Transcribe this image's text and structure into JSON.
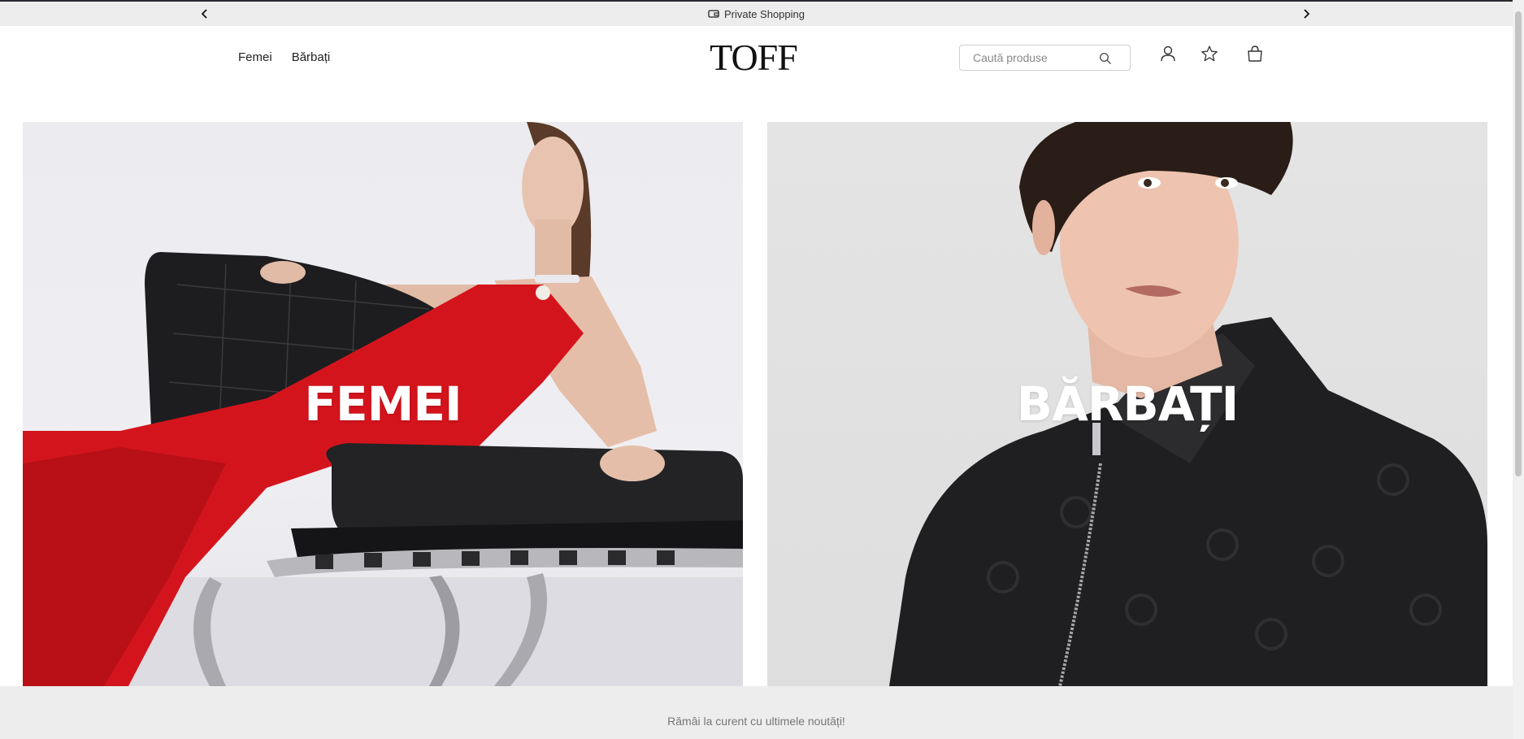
{
  "announcement": {
    "text": "Private Shopping",
    "icon": "wallet-icon",
    "prev_icon": "chevron-left-icon",
    "next_icon": "chevron-right-icon"
  },
  "header": {
    "logo": "TOFF",
    "nav": [
      {
        "label": "Femei"
      },
      {
        "label": "Bărbați"
      }
    ],
    "search": {
      "placeholder": "Caută produse",
      "value": "",
      "icon": "search-icon"
    },
    "icons": [
      "account-icon",
      "star-icon",
      "bag-icon"
    ]
  },
  "hero": {
    "women": {
      "label": "FEMEI"
    },
    "men": {
      "label": "BĂRBAȚI"
    }
  },
  "newsletter": {
    "text": "Rămâi la curent cu ultimele noutăți!"
  },
  "colors": {
    "bar_background": "#ededed",
    "text": "#222222",
    "dress_red": "#d4141c"
  }
}
